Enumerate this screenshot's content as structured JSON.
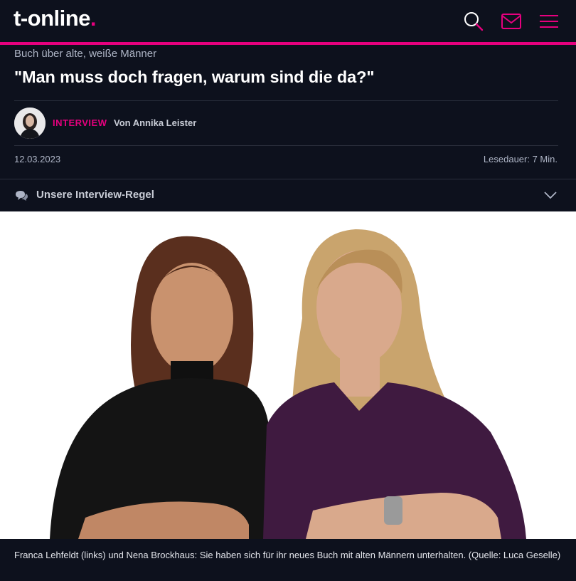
{
  "header": {
    "logo_text": "t-online",
    "logo_dot": ".",
    "accent_color": "#e6007e",
    "icons": [
      "search-icon",
      "mail-icon",
      "menu-icon"
    ]
  },
  "article": {
    "kicker": "Buch über alte, weiße Männer",
    "headline": "\"Man muss doch fragen, warum sind die da?\"",
    "tag": "INTERVIEW",
    "author": "Von Annika Leister",
    "date": "12.03.2023",
    "read_time": "Lesedauer: 7 Min.",
    "interview_rule_label": "Unsere Interview-Regel"
  },
  "image": {
    "caption": "Franca Lehfeldt (links) und Nena Brockhaus: Sie haben sich für ihr neues Buch mit alten Männern unterhalten. (Quelle: Luca Geselle)"
  }
}
